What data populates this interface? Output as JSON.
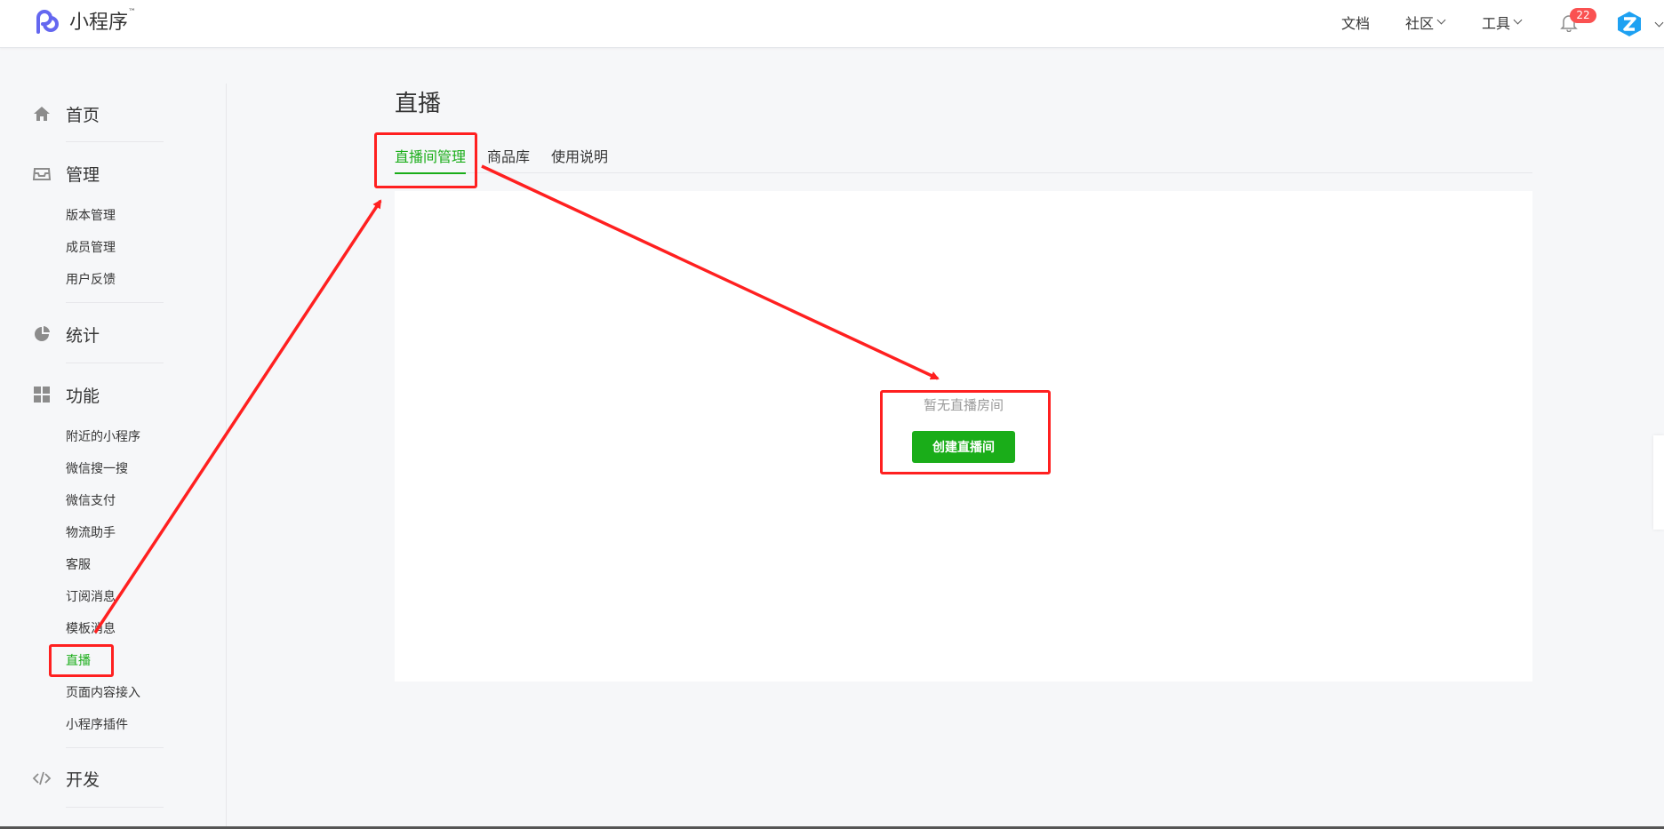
{
  "header": {
    "brand": "小程序",
    "trademark": "™",
    "nav": [
      {
        "label": "文档"
      },
      {
        "label": "社区"
      },
      {
        "label": "工具"
      }
    ],
    "notification_count": "22"
  },
  "sidebar": {
    "sections": [
      {
        "label": "首页",
        "icon": "home-icon"
      },
      {
        "label": "管理",
        "icon": "inbox-icon",
        "items": [
          "版本管理",
          "成员管理",
          "用户反馈"
        ]
      },
      {
        "label": "统计",
        "icon": "pie-chart-icon"
      },
      {
        "label": "功能",
        "icon": "grid-icon",
        "items": [
          "附近的小程序",
          "微信搜一搜",
          "微信支付",
          "物流助手",
          "客服",
          "订阅消息",
          "模板消息",
          "直播",
          "页面内容接入",
          "小程序插件"
        ]
      },
      {
        "label": "开发",
        "icon": "code-icon"
      }
    ],
    "active_item": "直播"
  },
  "main": {
    "title": "直播",
    "tabs": [
      {
        "label": "直播间管理",
        "active": true
      },
      {
        "label": "商品库",
        "active": false
      },
      {
        "label": "使用说明",
        "active": false
      }
    ],
    "empty_text": "暂无直播房间",
    "create_button": "创建直播间"
  },
  "colors": {
    "accent_green": "#1aad19",
    "annotation_red": "#ff2020",
    "badge_red": "#fa5151"
  }
}
